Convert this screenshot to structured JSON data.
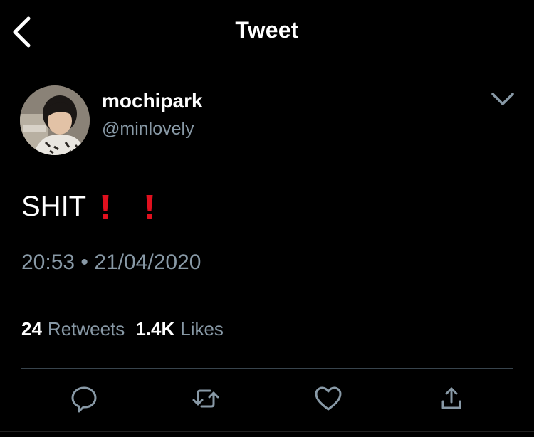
{
  "header": {
    "title": "Tweet",
    "back_icon": "chevron-left-icon"
  },
  "tweet": {
    "author": {
      "display_name": "mochipark",
      "handle": "@minlovely",
      "avatar": "avatar-photo"
    },
    "text": "SHIT",
    "emoji": [
      "red-exclamation-mark",
      "red-exclamation-mark"
    ],
    "emoji_color": "#e0101e",
    "time": "20:53",
    "separator": "•",
    "date": "21/04/2020",
    "stats": {
      "retweets_count": "24",
      "retweets_label": "Retweets",
      "likes_count": "1.4K",
      "likes_label": "Likes"
    }
  },
  "actions": [
    "reply-icon",
    "retweet-icon",
    "like-icon",
    "share-icon"
  ],
  "colors": {
    "background": "#000000",
    "text": "#ffffff",
    "secondary": "#8899a6",
    "divider": "#38444d"
  }
}
